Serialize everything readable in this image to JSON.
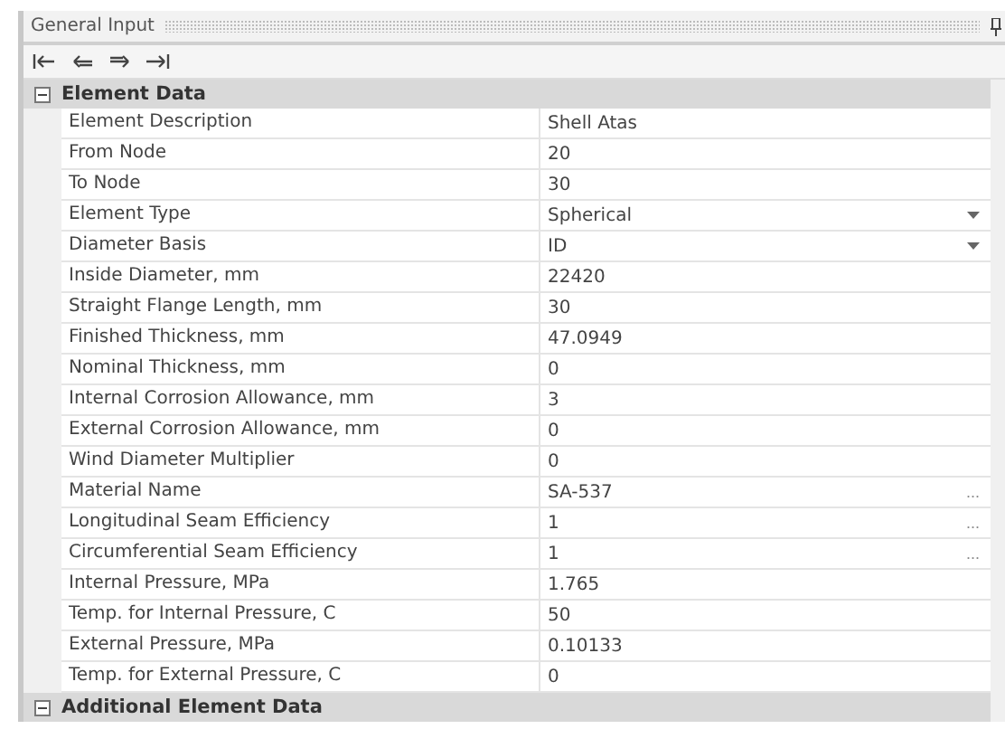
{
  "panel": {
    "title": "General Input"
  },
  "toolbar": [
    {
      "kind": "first"
    },
    {
      "kind": "prev"
    },
    {
      "kind": "next"
    },
    {
      "kind": "last"
    }
  ],
  "sections": [
    {
      "title": "Element Data",
      "expanded": true,
      "rows": [
        {
          "label": "Element Description",
          "value": "Shell Atas",
          "kind": "text"
        },
        {
          "label": "From Node",
          "value": "20",
          "kind": "text"
        },
        {
          "label": "To Node",
          "value": "30",
          "kind": "text"
        },
        {
          "label": "Element Type",
          "value": "Spherical",
          "kind": "dropdown"
        },
        {
          "label": "Diameter Basis",
          "value": "ID",
          "kind": "dropdown"
        },
        {
          "label": "Inside Diameter, mm",
          "value": "22420",
          "kind": "text"
        },
        {
          "label": "Straight Flange Length, mm",
          "value": "30",
          "kind": "text"
        },
        {
          "label": "Finished Thickness, mm",
          "value": "47.0949",
          "kind": "text"
        },
        {
          "label": "Nominal Thickness, mm",
          "value": "0",
          "kind": "text"
        },
        {
          "label": "Internal Corrosion Allowance, mm",
          "value": "3",
          "kind": "text"
        },
        {
          "label": "External Corrosion Allowance, mm",
          "value": "0",
          "kind": "text"
        },
        {
          "label": "Wind Diameter Multiplier",
          "value": "0",
          "kind": "text"
        },
        {
          "label": "Material Name",
          "value": "SA-537",
          "kind": "browse",
          "button": "..."
        },
        {
          "label": "Longitudinal Seam Efficiency",
          "value": "1",
          "kind": "browse",
          "button": "..."
        },
        {
          "label": "Circumferential Seam Efficiency",
          "value": "1",
          "kind": "browse",
          "button": "..."
        },
        {
          "label": "Internal Pressure, MPa",
          "value": "1.765",
          "kind": "text"
        },
        {
          "label": "Temp. for Internal Pressure, C",
          "value": "50",
          "kind": "text"
        },
        {
          "label": "External Pressure, MPa",
          "value": "0.10133",
          "kind": "text"
        },
        {
          "label": "Temp. for External Pressure, C",
          "value": "0",
          "kind": "text"
        }
      ]
    },
    {
      "title": "Additional Element Data",
      "expanded": true
    }
  ]
}
